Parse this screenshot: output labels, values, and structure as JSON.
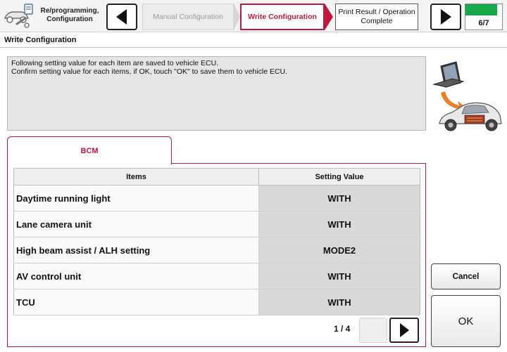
{
  "header": {
    "app_title": "Re/programming, Configuration",
    "steps": {
      "previous": "Manual Configuration",
      "current": "Write Configuration",
      "upcoming": "Print Result / Operation Complete"
    },
    "progress": {
      "text": "6/7",
      "fraction": 0.857
    }
  },
  "section_title": "Write Configuration",
  "message": {
    "line1": "Following setting value for each item are saved to vehicle ECU.",
    "line2": "Confirm setting value for each items, if OK, touch \"OK\" to save them to vehicle ECU."
  },
  "tab": {
    "label": "BCM"
  },
  "table": {
    "headers": {
      "items": "Items",
      "setting_value": "Setting Value"
    },
    "rows": [
      {
        "item": "Daytime running light",
        "value": "WITH"
      },
      {
        "item": "Lane camera unit",
        "value": "WITH"
      },
      {
        "item": "High beam assist / ALH setting",
        "value": "MODE2"
      },
      {
        "item": "AV control unit",
        "value": "WITH"
      },
      {
        "item": "TCU",
        "value": "WITH"
      }
    ]
  },
  "pagination": {
    "text": "1 / 4"
  },
  "buttons": {
    "cancel": "Cancel",
    "ok": "OK"
  },
  "icons": {
    "app": "tools-car-icon",
    "back": "triangle-left-icon",
    "next": "triangle-right-icon",
    "illustration": "laptop-to-car-icon"
  },
  "colors": {
    "accent": "#c0173e",
    "progress": "#17a84a"
  }
}
